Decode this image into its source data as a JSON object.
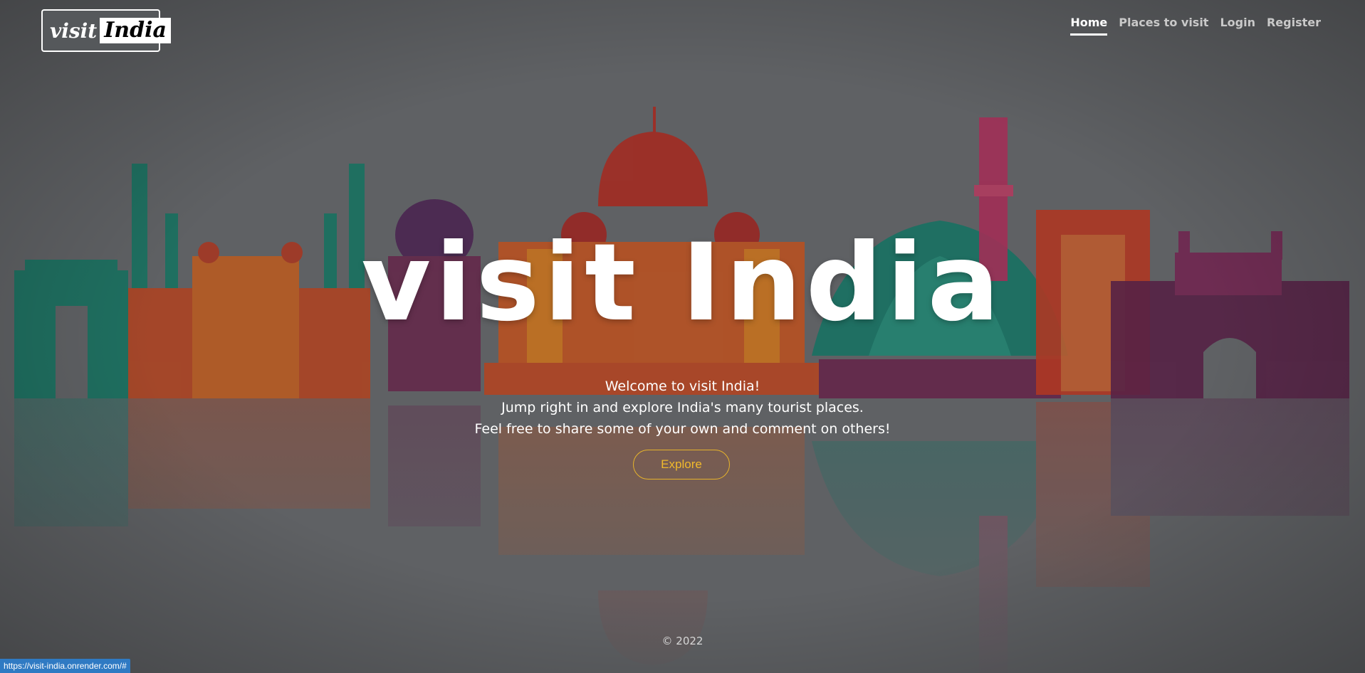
{
  "brand": {
    "logo_word1": "visit",
    "logo_word2": "India"
  },
  "nav": {
    "items": [
      {
        "label": "Home",
        "active": true
      },
      {
        "label": "Places to visit",
        "active": false
      },
      {
        "label": "Login",
        "active": false
      },
      {
        "label": "Register",
        "active": false
      }
    ]
  },
  "hero": {
    "title": "visit India",
    "lines": [
      "Welcome to visit India!",
      "Jump right in and explore India's many tourist places.",
      "Feel free to share some of your own and comment on others!"
    ],
    "button": "Explore"
  },
  "footer": {
    "copyright": "© 2022"
  },
  "status_bar": {
    "url": "https://visit-india.onrender.com/#"
  },
  "colors": {
    "accent": "#f0b92c",
    "background": "#74777b",
    "status_bar": "#2f7ac3"
  }
}
